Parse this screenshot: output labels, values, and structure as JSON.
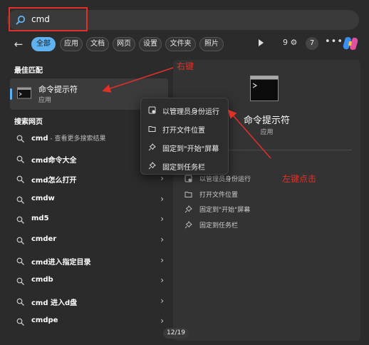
{
  "search": {
    "query": "cmd"
  },
  "filters": {
    "chips": [
      "全部",
      "应用",
      "文档",
      "网页",
      "设置",
      "文件夹",
      "照片"
    ],
    "rewards_count": "9",
    "badge_count": "7",
    "more_label": "•••"
  },
  "best_match": {
    "section_title": "最佳匹配",
    "name": "命令提示符",
    "type": "应用"
  },
  "web": {
    "section_title": "搜索网页",
    "items": [
      {
        "main": "cmd",
        "muted": " - 查看更多搜索结果"
      },
      {
        "main": "cmd命令大全",
        "muted": ""
      },
      {
        "main": "cmd怎么打开",
        "muted": ""
      },
      {
        "main": "cmdw",
        "muted": ""
      },
      {
        "main": "md5",
        "muted": ""
      },
      {
        "main": "cmder",
        "muted": ""
      },
      {
        "main": "cmd进入指定目录",
        "muted": ""
      },
      {
        "main": "cmdb",
        "muted": ""
      },
      {
        "main": "cmd 进入d盘",
        "muted": ""
      },
      {
        "main": "cmdpe",
        "muted": ""
      }
    ]
  },
  "detail": {
    "title": "命令提示符",
    "type": "应用",
    "actions": [
      "以管理员身份运行",
      "打开文件位置",
      "固定到\"开始\"屏幕",
      "固定到任务栏"
    ]
  },
  "context_menu": {
    "items": [
      "以管理员身份运行",
      "打开文件位置",
      "固定到\"开始\"屏幕",
      "固定到任务栏"
    ]
  },
  "annotations": {
    "right_click": "右键",
    "left_click": "左键点击",
    "color": "#e0302a"
  },
  "pager": {
    "label": "12/19"
  },
  "colors": {
    "accent": "#5fb2ef",
    "background": "#2b2b2b"
  }
}
